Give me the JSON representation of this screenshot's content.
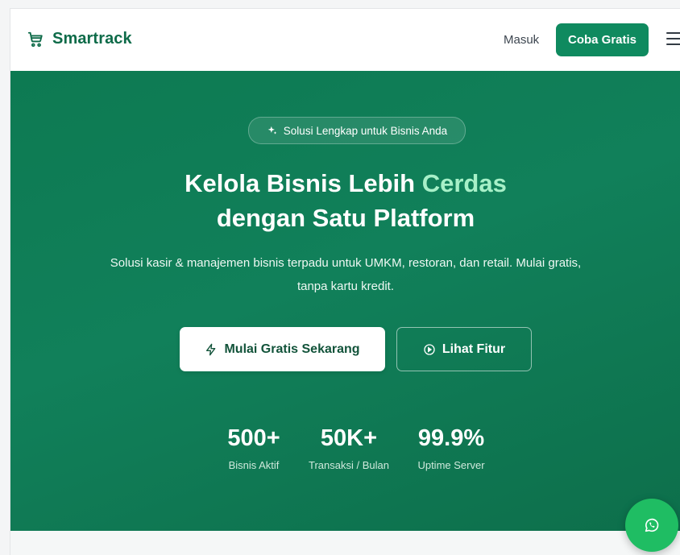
{
  "header": {
    "brand": "Smartrack",
    "brand_icon": "shopping-cart-icon",
    "login_label": "Masuk",
    "cta_label": "Coba Gratis",
    "menu_icon": "hamburger-menu-icon"
  },
  "hero": {
    "badge": "Solusi Lengkap untuk Bisnis Anda",
    "badge_icon": "sparkles-icon",
    "title_part1": "Kelola Bisnis Lebih ",
    "title_accent": "Cerdas",
    "title_line2": "dengan Satu Platform",
    "subtitle": "Solusi kasir & manajemen bisnis terpadu untuk UMKM, restoran, dan retail. Mulai gratis, tanpa kartu kredit.",
    "primary_cta": "Mulai Gratis Sekarang",
    "primary_cta_icon": "lightning-icon",
    "secondary_cta": "Lihat Fitur",
    "secondary_cta_icon": "play-circle-icon",
    "stats": [
      {
        "value": "500+",
        "label": "Bisnis Aktif"
      },
      {
        "value": "50K+",
        "label": "Transaksi / Bulan"
      },
      {
        "value": "99.9%",
        "label": "Uptime Server"
      }
    ]
  },
  "fab": {
    "icon": "whatsapp-icon"
  },
  "colors": {
    "brand": "#0e6b49",
    "primary_button": "#0f8a5f",
    "hero_bg": "#0d7a52",
    "accent_text": "#a7f0c8",
    "whatsapp": "#1fbd63"
  }
}
